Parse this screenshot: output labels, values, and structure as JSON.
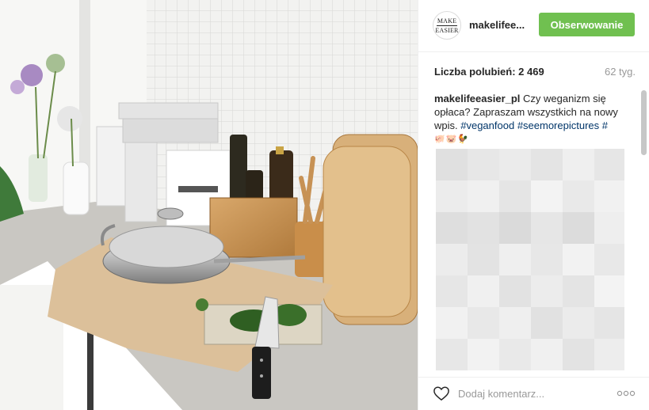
{
  "header": {
    "avatar_line1": "MAKE",
    "avatar_line2": "EASIER",
    "username": "makelifee...",
    "follow_label": "Obserwowanie"
  },
  "stats": {
    "likes": "Liczba polubień: 2 469",
    "time": "62 tyg."
  },
  "caption": {
    "user": "makelifeeasier_pl",
    "text": " Czy weganizm się opłaca? Zapraszam wszystkich na nowy wpis. ",
    "hashtag1": "#veganfood",
    "hashtag2": "#seemorepictures",
    "hashtag3": "#",
    "emojis": "🐖🐷🐓"
  },
  "footer": {
    "comment_placeholder": "Dodaj komentarz..."
  },
  "colors": {
    "follow_green": "#70c050",
    "hashtag_blue": "#003569",
    "muted": "#999999"
  },
  "icons": {
    "like": "heart-outline-icon",
    "more": "more-options-icon"
  }
}
